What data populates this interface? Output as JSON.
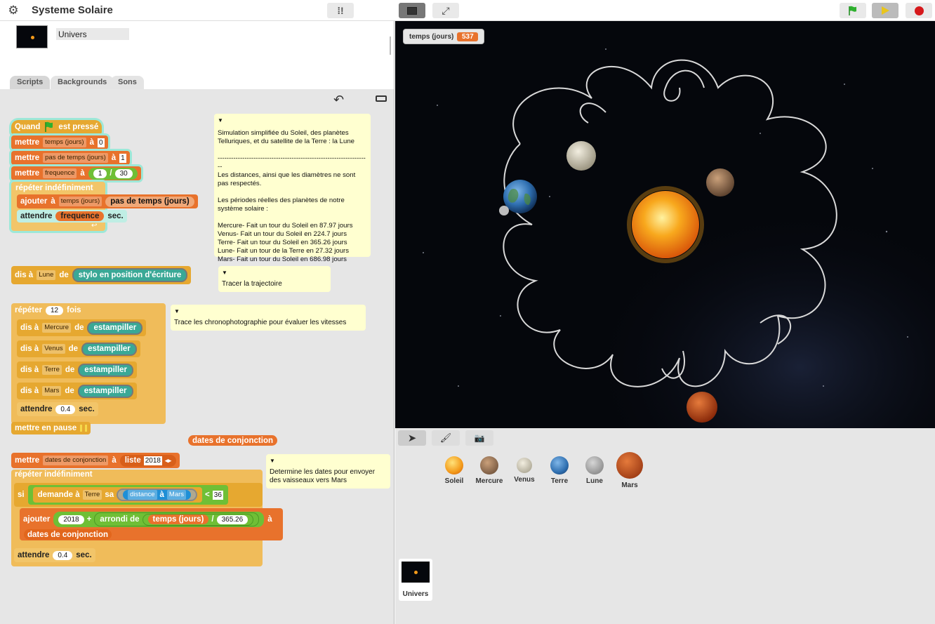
{
  "app": {
    "title": "Systeme Solaire"
  },
  "sprite": {
    "name": "Univers"
  },
  "tabs": [
    "Scripts",
    "Backgrounds",
    "Sons"
  ],
  "stage": {
    "watcher_label": "temps (jours)",
    "watcher_value": "537",
    "dates_watcher": "dates de conjonction"
  },
  "script1": {
    "hat": "Quand",
    "hat2": "est pressé",
    "set": "mettre",
    "var_temps": "temps (jours)",
    "to": "à",
    "val0": "0",
    "var_pas": "pas de temps (jours)",
    "val1": "1",
    "var_freq": "frequence",
    "num": "1",
    "slash": "/",
    "den": "30",
    "forever": "répéter indéfiniment",
    "add": "ajouter",
    "add_to": "à",
    "add_var": "temps (jours)",
    "add_reporter": "pas de temps (jours)",
    "wait": "attendre",
    "wait_rep": "frequence",
    "sec": "sec."
  },
  "note1": {
    "text": "Simulation simplifiée du Soleil, des planètes Telluriques, et du satellite de la Terre : la Lune\n\n--------------------------------------------------------------------\nLes distances, ainsi que les diamètres ne sont pas respectés.\n\nLes périodes réelles des planètes de notre système solaire :\n\nMercure- Fait un tour du Soleil en 87.97 jours\nVenus- Fait un tour du Soleil en 224.7 jours\nTerre- Fait un tour du Soleil en 365.26 jours\nLune- Fait un tour de la Terre en 27.32 jours\nMars- Fait un tour du Soleil en 686.98 jours"
  },
  "script2": {
    "say": "dis à",
    "target": "Lune",
    "de": "de",
    "reporter": "stylo en position d'écriture"
  },
  "note2": {
    "text": "Tracer la trajectoire"
  },
  "script3": {
    "repeat": "répéter",
    "count": "12",
    "times": "fois",
    "say": "dis à",
    "de": "de",
    "targets": [
      "Mercure",
      "Venus",
      "Terre",
      "Mars"
    ],
    "stamp": "estampiller",
    "wait": "attendre",
    "wait_val": "0.4",
    "sec": "sec.",
    "pause": "mettre en pause"
  },
  "note3": {
    "text": "Trace les chronophotographie pour évaluer les vitesses"
  },
  "script4": {
    "set": "mettre",
    "var": "dates de conjonction",
    "to": "à",
    "list": "liste",
    "list_val": "2018",
    "forever": "répéter indéfiniment",
    "if": "si",
    "ask": "demande à",
    "ask_target": "Terre",
    "ask_sa": "sa",
    "attr": "distance",
    "attr_to": "à",
    "attr_target": "Mars",
    "lt": "<",
    "lt_val": "36",
    "add": "ajouter",
    "add_val": "2018",
    "plus": "+",
    "round": "arrondi de",
    "round_rep": "temps (jours)",
    "div": "/",
    "div_val": "365.26",
    "add_to": "à",
    "add_list": "dates de conjonction",
    "wait": "attendre",
    "wait_val": "0.4",
    "sec": "sec."
  },
  "note4": {
    "text": "Determine les dates pour envoyer des vaisseaux vers Mars"
  },
  "sprites": [
    {
      "name": "Soleil",
      "color": "#f39a1a"
    },
    {
      "name": "Mercure",
      "color": "#9b7a5c"
    },
    {
      "name": "Venus",
      "color": "#d8d2c0"
    },
    {
      "name": "Terre",
      "color": "#3b77b8"
    },
    {
      "name": "Lune",
      "color": "#9a9a9a"
    },
    {
      "name": "Mars",
      "color": "#c9531c"
    }
  ],
  "stage_icon": {
    "name": "Univers"
  },
  "colors": {
    "motion": "#1f8fd6",
    "variables": "#e8722c",
    "control": "#e6a830",
    "pen": "#3aa896",
    "operators": "#6fbf36"
  }
}
